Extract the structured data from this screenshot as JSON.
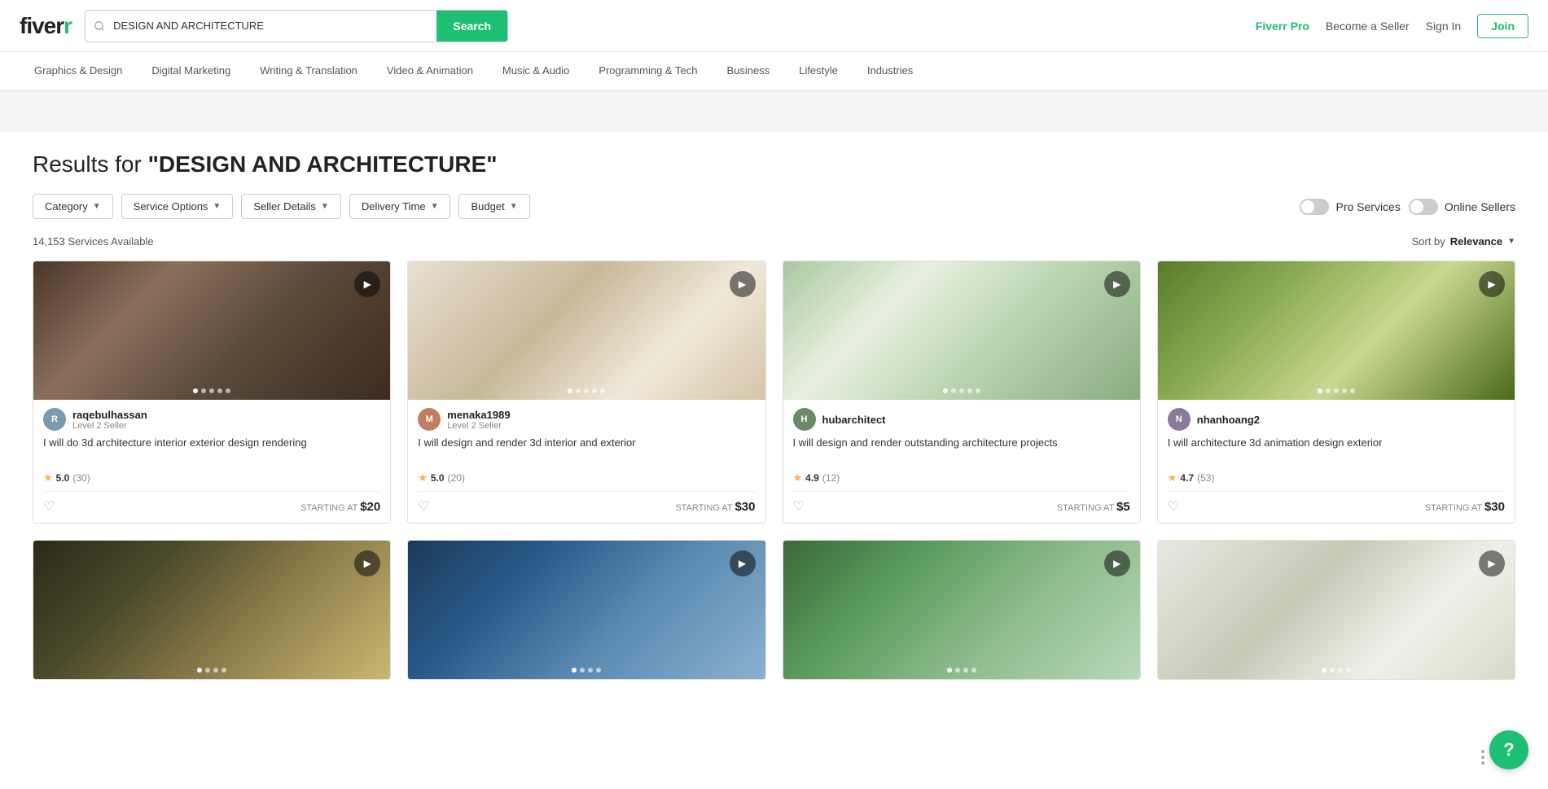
{
  "header": {
    "logo": "fiverr",
    "search": {
      "value": "DESIGN AND ARCHITECTURE",
      "placeholder": "DESIGN AND ARCHITECTURE",
      "button_label": "Search"
    },
    "nav": {
      "fiverr_pro": "Fiverr Pro",
      "become_seller": "Become a Seller",
      "sign_in": "Sign In",
      "join": "Join"
    }
  },
  "categories": [
    "Graphics & Design",
    "Digital Marketing",
    "Writing & Translation",
    "Video & Animation",
    "Music & Audio",
    "Programming & Tech",
    "Business",
    "Lifestyle",
    "Industries"
  ],
  "results": {
    "title_prefix": "Results for ",
    "query": "\"DESIGN AND ARCHITECTURE\"",
    "count": "14,153 Services Available",
    "sort_label": "Sort by",
    "sort_value": "Relevance"
  },
  "filters": [
    {
      "label": "Category",
      "id": "category-filter"
    },
    {
      "label": "Service Options",
      "id": "service-options-filter"
    },
    {
      "label": "Seller Details",
      "id": "seller-details-filter"
    },
    {
      "label": "Delivery Time",
      "id": "delivery-time-filter"
    },
    {
      "label": "Budget",
      "id": "budget-filter"
    }
  ],
  "toggles": [
    {
      "label": "Pro Services",
      "id": "pro-services-toggle",
      "on": false
    },
    {
      "label": "Online Sellers",
      "id": "online-sellers-toggle",
      "on": false
    }
  ],
  "cards": [
    {
      "id": "card-1",
      "seller": {
        "name": "raqebulhassan",
        "level": "Level 2 Seller",
        "initials": "R"
      },
      "title": "I will do 3d architecture interior exterior design rendering",
      "rating": "5.0",
      "reviews": "(30)",
      "starting_at": "STARTING AT",
      "price": "$20",
      "img_class": "img-1",
      "dots": [
        true,
        false,
        false,
        false,
        false
      ]
    },
    {
      "id": "card-2",
      "seller": {
        "name": "menaka1989",
        "level": "Level 2 Seller",
        "initials": "M"
      },
      "title": "I will design and render 3d interior and exterior",
      "rating": "5.0",
      "reviews": "(20)",
      "starting_at": "STARTING AT",
      "price": "$30",
      "img_class": "img-2",
      "dots": [
        true,
        false,
        false,
        false,
        false
      ]
    },
    {
      "id": "card-3",
      "seller": {
        "name": "hubarchitect",
        "level": "",
        "initials": "H"
      },
      "title": "I will design and render outstanding architecture projects",
      "rating": "4.9",
      "reviews": "(12)",
      "starting_at": "STARTING AT",
      "price": "$5",
      "img_class": "img-3",
      "dots": [
        true,
        false,
        false,
        false,
        false
      ]
    },
    {
      "id": "card-4",
      "seller": {
        "name": "nhanhoang2",
        "level": "",
        "initials": "N"
      },
      "title": "I will architecture 3d animation design exterior",
      "rating": "4.7",
      "reviews": "(53)",
      "starting_at": "STARTING AT",
      "price": "$30",
      "img_class": "img-4",
      "dots": [
        true,
        false,
        false,
        false,
        false
      ]
    },
    {
      "id": "card-5",
      "seller": {
        "name": "",
        "level": "",
        "initials": ""
      },
      "title": "",
      "rating": "",
      "reviews": "",
      "starting_at": "",
      "price": "",
      "img_class": "img-5",
      "dots": []
    },
    {
      "id": "card-6",
      "seller": {
        "name": "",
        "level": "",
        "initials": ""
      },
      "title": "",
      "rating": "",
      "reviews": "",
      "starting_at": "",
      "price": "",
      "img_class": "img-6",
      "dots": []
    },
    {
      "id": "card-7",
      "seller": {
        "name": "",
        "level": "",
        "initials": ""
      },
      "title": "",
      "rating": "",
      "reviews": "",
      "starting_at": "",
      "price": "",
      "img_class": "img-7",
      "dots": []
    },
    {
      "id": "card-8",
      "seller": {
        "name": "",
        "level": "",
        "initials": ""
      },
      "title": "",
      "rating": "",
      "reviews": "",
      "starting_at": "",
      "price": "",
      "img_class": "img-8",
      "dots": []
    }
  ],
  "help_button": "?"
}
